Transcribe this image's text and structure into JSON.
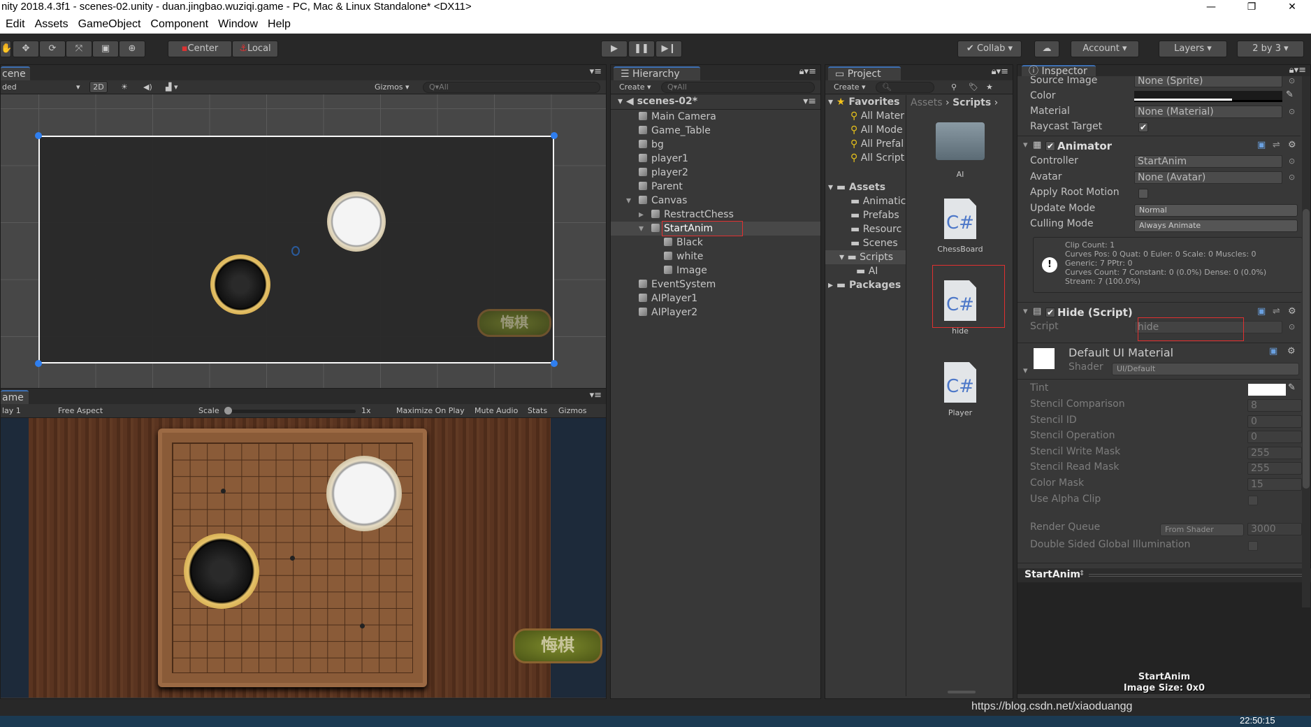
{
  "window": {
    "title": "nity 2018.4.3f1 - scenes-02.unity - duan.jingbao.wuziqi.game - PC, Mac & Linux Standalone* <DX11>"
  },
  "menu": [
    "Edit",
    "Assets",
    "GameObject",
    "Component",
    "Window",
    "Help"
  ],
  "toolbar": {
    "pivot": "Center",
    "space": "Local",
    "collab": "Collab",
    "account": "Account",
    "layers": "Layers",
    "layout": "2 by 3"
  },
  "scene": {
    "tab": "cene",
    "shading": "ded",
    "mode2d": "2D",
    "gizmos": "Gizmos",
    "search_placeholder": "Q▾All",
    "button_text": "悔棋"
  },
  "game": {
    "tab": "ame",
    "display": "lay 1",
    "aspect": "Free Aspect",
    "scale_label": "Scale",
    "scale_value": "1x",
    "maximize": "Maximize On Play",
    "mute": "Mute Audio",
    "stats": "Stats",
    "gizmos": "Gizmos",
    "button_text": "悔棋"
  },
  "hierarchy": {
    "tab": "Hierarchy",
    "create": "Create",
    "search_placeholder": "Q▾All",
    "scene": "scenes-02*",
    "items": [
      {
        "label": "Main Camera",
        "depth": 0
      },
      {
        "label": "Game_Table",
        "depth": 0
      },
      {
        "label": "bg",
        "depth": 0
      },
      {
        "label": "player1",
        "depth": 0
      },
      {
        "label": "player2",
        "depth": 0
      },
      {
        "label": "Parent",
        "depth": 0
      },
      {
        "label": "Canvas",
        "depth": 0,
        "expanded": true
      },
      {
        "label": "RestractChess",
        "depth": 1,
        "collapsed": true
      },
      {
        "label": "StartAnim",
        "depth": 1,
        "expanded": true,
        "selected": true
      },
      {
        "label": "Black",
        "depth": 2
      },
      {
        "label": "white",
        "depth": 2
      },
      {
        "label": "Image",
        "depth": 2
      },
      {
        "label": "EventSystem",
        "depth": 0
      },
      {
        "label": "AIPlayer1",
        "depth": 0
      },
      {
        "label": "AIPlayer2",
        "depth": 0
      }
    ]
  },
  "project": {
    "tab": "Project",
    "create": "Create",
    "favorites": "Favorites",
    "fav_items": [
      "All Mater",
      "All Mode",
      "All Prefal",
      "All Script"
    ],
    "assets": "Assets",
    "asset_items": [
      "Animatic",
      "Prefabs",
      "Resourc",
      "Scenes",
      "Scripts"
    ],
    "scripts_child": "AI",
    "packages": "Packages",
    "breadcrumb": [
      "Assets",
      "Scripts"
    ],
    "grid": [
      {
        "label": "AI",
        "type": "folder"
      },
      {
        "label": "ChessBoard",
        "type": "cs"
      },
      {
        "label": "hide",
        "type": "cs",
        "highlighted": true
      },
      {
        "label": "Player",
        "type": "cs"
      }
    ]
  },
  "inspector": {
    "tab": "Inspector",
    "image": {
      "source_image_label": "Source Image",
      "source_image": "None (Sprite)",
      "color_label": "Color",
      "material_label": "Material",
      "material": "None (Material)",
      "raycast_label": "Raycast Target",
      "raycast": true
    },
    "animator": {
      "title": "Animator",
      "controller_label": "Controller",
      "controller": "StartAnim",
      "avatar_label": "Avatar",
      "avatar": "None (Avatar)",
      "root_motion_label": "Apply Root Motion",
      "update_label": "Update Mode",
      "update": "Normal",
      "culling_label": "Culling Mode",
      "culling": "Always Animate",
      "info": [
        "Clip Count: 1",
        "Curves Pos: 0 Quat: 0 Euler: 0 Scale: 0 Muscles: 0",
        "Generic: 7 PPtr: 0",
        "Curves Count: 7 Constant: 0 (0.0%) Dense: 0 (0.0%)",
        "Stream: 7 (100.0%)"
      ]
    },
    "hide": {
      "title": "Hide (Script)",
      "script_label": "Script",
      "script": "hide"
    },
    "material": {
      "title": "Default UI Material",
      "shader_label": "Shader",
      "shader": "UI/Default",
      "tint_label": "Tint",
      "props": [
        {
          "label": "Stencil Comparison",
          "value": "8"
        },
        {
          "label": "Stencil ID",
          "value": "0"
        },
        {
          "label": "Stencil Operation",
          "value": "0"
        },
        {
          "label": "Stencil Write Mask",
          "value": "255"
        },
        {
          "label": "Stencil Read Mask",
          "value": "255"
        },
        {
          "label": "Color Mask",
          "value": "15"
        }
      ],
      "alpha_clip_label": "Use Alpha Clip",
      "render_queue_label": "Render Queue",
      "render_queue_mode": "From Shader",
      "render_queue": "3000",
      "dsgi_label": "Double Sided Global Illumination"
    },
    "preview": {
      "name": "StartAnim",
      "title": "StartAnim",
      "size": "Image Size: 0x0"
    }
  },
  "watermark": "https://blog.csdn.net/xiaoduangg",
  "clock": "22:50:15",
  "colors": {
    "accent": "#3d6fb2",
    "selection_box": "#e03030",
    "panel": "#383838"
  }
}
